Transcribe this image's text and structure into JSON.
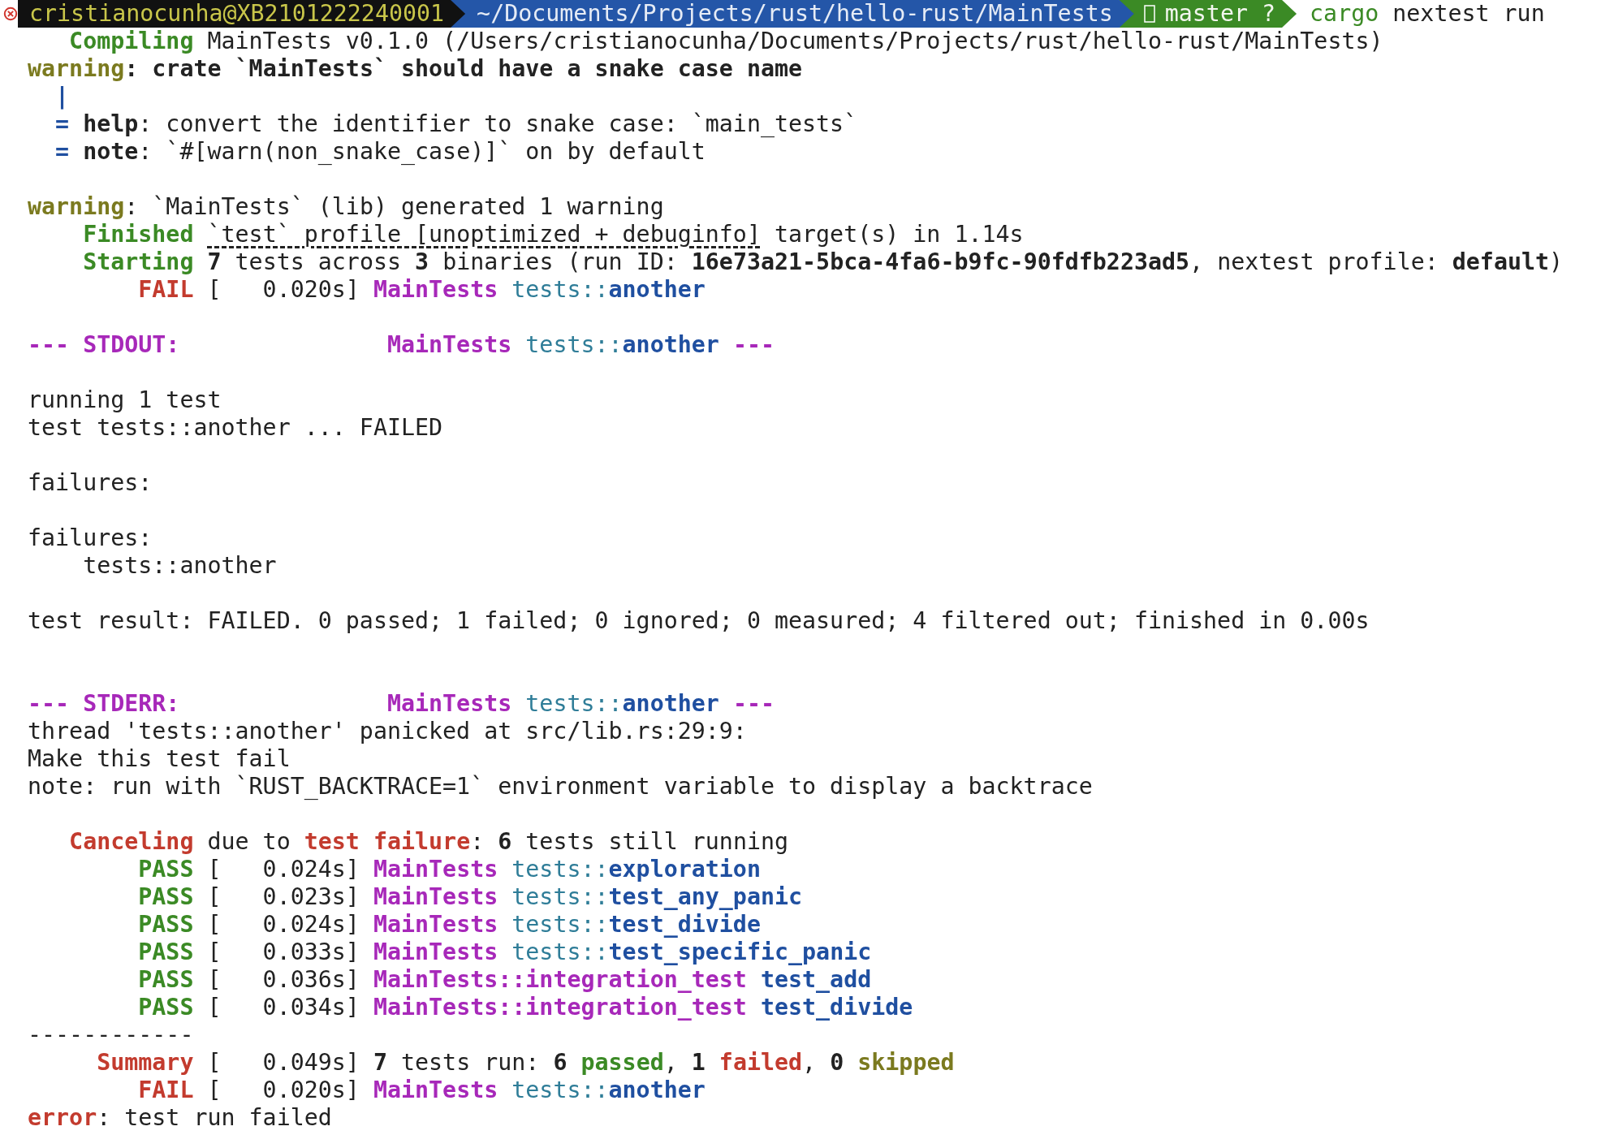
{
  "prompt": {
    "user_host": "cristianocunha@XB2101222240001",
    "path": "~/Documents/Projects/rust/hello-rust/MainTests",
    "branch": "master ?",
    "command": [
      {
        "text": "cargo",
        "kind": "program"
      },
      {
        "text": " nextest run",
        "kind": "text"
      }
    ]
  },
  "lines": [
    {
      "kind": "text",
      "segments": [
        {
          "text": "   Compiling",
          "kind": "status_ok"
        },
        {
          "text": " MainTests v0.1.0 (/Users/cristianocunha/Documents/Projects/rust/hello-rust/MainTests)",
          "kind": "text"
        }
      ]
    },
    {
      "kind": "text",
      "segments": [
        {
          "text": "warning",
          "kind": "warning"
        },
        {
          "text": ": crate `MainTests` should have a snake case name",
          "kind": "emphasis"
        }
      ]
    },
    {
      "kind": "text",
      "segments": [
        {
          "text": "  |",
          "kind": "gutter"
        }
      ]
    },
    {
      "kind": "text",
      "segments": [
        {
          "text": "  =",
          "kind": "gutter"
        },
        {
          "text": " help",
          "kind": "emphasis"
        },
        {
          "text": ": convert the identifier to snake case: `main_tests`",
          "kind": "text"
        }
      ]
    },
    {
      "kind": "text",
      "segments": [
        {
          "text": "  =",
          "kind": "gutter"
        },
        {
          "text": " note",
          "kind": "emphasis"
        },
        {
          "text": ": `#[warn(non_snake_case)]` on by default",
          "kind": "text"
        }
      ]
    },
    {
      "kind": "blank"
    },
    {
      "kind": "text",
      "segments": [
        {
          "text": "warning",
          "kind": "warning"
        },
        {
          "text": ": `MainTests` (lib) generated 1 warning",
          "kind": "text"
        }
      ]
    },
    {
      "kind": "text",
      "segments": [
        {
          "text": "    Finished ",
          "kind": "status_ok"
        },
        {
          "text": "`test` profile [unoptimized + debuginfo]",
          "kind": "underlined"
        },
        {
          "text": " target(s) in 1.14s",
          "kind": "text"
        }
      ]
    },
    {
      "kind": "text",
      "segments": [
        {
          "text": "    Starting ",
          "kind": "status_ok"
        },
        {
          "text": "7",
          "kind": "emphasis"
        },
        {
          "text": " tests across ",
          "kind": "text"
        },
        {
          "text": "3",
          "kind": "emphasis"
        },
        {
          "text": " binaries (run ID: ",
          "kind": "text"
        },
        {
          "text": "16e73a21-5bca-4fa6-b9fc-90fdfb223ad5",
          "kind": "emphasis"
        },
        {
          "text": ", nextest profile: ",
          "kind": "text"
        },
        {
          "text": "default",
          "kind": "emphasis"
        },
        {
          "text": ")",
          "kind": "text"
        }
      ]
    },
    {
      "kind": "text",
      "segments": [
        {
          "text": "        FAIL",
          "kind": "status_fail"
        },
        {
          "text": " [   0.020s] ",
          "kind": "text"
        },
        {
          "text": "MainTests",
          "kind": "crate"
        },
        {
          "text": " tests::",
          "kind": "module"
        },
        {
          "text": "another",
          "kind": "test_name"
        }
      ]
    },
    {
      "kind": "blank"
    },
    {
      "kind": "text",
      "segments": [
        {
          "text": "--- STDOUT:               MainTests",
          "kind": "crate"
        },
        {
          "text": " tests::",
          "kind": "module"
        },
        {
          "text": "another",
          "kind": "test_name"
        },
        {
          "text": " ---",
          "kind": "crate"
        }
      ]
    },
    {
      "kind": "blank"
    },
    {
      "kind": "text",
      "segments": [
        {
          "text": "running 1 test",
          "kind": "text"
        }
      ]
    },
    {
      "kind": "text",
      "segments": [
        {
          "text": "test tests::another ... FAILED",
          "kind": "text"
        }
      ]
    },
    {
      "kind": "blank"
    },
    {
      "kind": "text",
      "segments": [
        {
          "text": "failures:",
          "kind": "text"
        }
      ]
    },
    {
      "kind": "blank"
    },
    {
      "kind": "text",
      "segments": [
        {
          "text": "failures:",
          "kind": "text"
        }
      ]
    },
    {
      "kind": "text",
      "segments": [
        {
          "text": "    tests::another",
          "kind": "text"
        }
      ]
    },
    {
      "kind": "blank"
    },
    {
      "kind": "text",
      "segments": [
        {
          "text": "test result: FAILED. 0 passed; 1 failed; 0 ignored; 0 measured; 4 filtered out; finished in 0.00s",
          "kind": "text"
        }
      ]
    },
    {
      "kind": "blank"
    },
    {
      "kind": "blank"
    },
    {
      "kind": "text",
      "segments": [
        {
          "text": "--- STDERR:               MainTests",
          "kind": "crate"
        },
        {
          "text": " tests::",
          "kind": "module"
        },
        {
          "text": "another",
          "kind": "test_name"
        },
        {
          "text": " ---",
          "kind": "crate"
        }
      ]
    },
    {
      "kind": "text",
      "segments": [
        {
          "text": "thread 'tests::another' panicked at src/lib.rs:29:9:",
          "kind": "text"
        }
      ]
    },
    {
      "kind": "text",
      "segments": [
        {
          "text": "Make this test fail",
          "kind": "text"
        }
      ]
    },
    {
      "kind": "text",
      "segments": [
        {
          "text": "note: run with `RUST_BACKTRACE=1` environment variable to display a backtrace",
          "kind": "text"
        }
      ]
    },
    {
      "kind": "blank"
    },
    {
      "kind": "text",
      "segments": [
        {
          "text": "   Canceling",
          "kind": "status_fail"
        },
        {
          "text": " due to ",
          "kind": "text"
        },
        {
          "text": "test failure",
          "kind": "status_fail"
        },
        {
          "text": ": ",
          "kind": "text"
        },
        {
          "text": "6",
          "kind": "emphasis"
        },
        {
          "text": " tests still running",
          "kind": "text"
        }
      ]
    },
    {
      "kind": "text",
      "segments": [
        {
          "text": "        PASS",
          "kind": "status_ok"
        },
        {
          "text": " [   0.024s] ",
          "kind": "text"
        },
        {
          "text": "MainTests",
          "kind": "crate"
        },
        {
          "text": " tests::",
          "kind": "module"
        },
        {
          "text": "exploration",
          "kind": "test_name"
        }
      ]
    },
    {
      "kind": "text",
      "segments": [
        {
          "text": "        PASS",
          "kind": "status_ok"
        },
        {
          "text": " [   0.023s] ",
          "kind": "text"
        },
        {
          "text": "MainTests",
          "kind": "crate"
        },
        {
          "text": " tests::",
          "kind": "module"
        },
        {
          "text": "test_any_panic",
          "kind": "test_name"
        }
      ]
    },
    {
      "kind": "text",
      "segments": [
        {
          "text": "        PASS",
          "kind": "status_ok"
        },
        {
          "text": " [   0.024s] ",
          "kind": "text"
        },
        {
          "text": "MainTests",
          "kind": "crate"
        },
        {
          "text": " tests::",
          "kind": "module"
        },
        {
          "text": "test_divide",
          "kind": "test_name"
        }
      ]
    },
    {
      "kind": "text",
      "segments": [
        {
          "text": "        PASS",
          "kind": "status_ok"
        },
        {
          "text": " [   0.033s] ",
          "kind": "text"
        },
        {
          "text": "MainTests",
          "kind": "crate"
        },
        {
          "text": " tests::",
          "kind": "module"
        },
        {
          "text": "test_specific_panic",
          "kind": "test_name"
        }
      ]
    },
    {
      "kind": "text",
      "segments": [
        {
          "text": "        PASS",
          "kind": "status_ok"
        },
        {
          "text": " [   0.036s] ",
          "kind": "text"
        },
        {
          "text": "MainTests::integration_test ",
          "kind": "crate"
        },
        {
          "text": "test_add",
          "kind": "test_name"
        }
      ]
    },
    {
      "kind": "text",
      "segments": [
        {
          "text": "        PASS",
          "kind": "status_ok"
        },
        {
          "text": " [   0.034s] ",
          "kind": "text"
        },
        {
          "text": "MainTests::integration_test ",
          "kind": "crate"
        },
        {
          "text": "test_divide",
          "kind": "test_name"
        }
      ]
    },
    {
      "kind": "text",
      "segments": [
        {
          "text": "------------",
          "kind": "text"
        }
      ]
    },
    {
      "kind": "text",
      "segments": [
        {
          "text": "     Summary",
          "kind": "status_fail"
        },
        {
          "text": " [   0.049s] ",
          "kind": "text"
        },
        {
          "text": "7",
          "kind": "emphasis"
        },
        {
          "text": " tests run: ",
          "kind": "text"
        },
        {
          "text": "6 ",
          "kind": "emphasis"
        },
        {
          "text": "passed",
          "kind": "status_ok"
        },
        {
          "text": ", ",
          "kind": "text"
        },
        {
          "text": "1 ",
          "kind": "emphasis"
        },
        {
          "text": "failed",
          "kind": "status_fail"
        },
        {
          "text": ", ",
          "kind": "text"
        },
        {
          "text": "0 ",
          "kind": "emphasis"
        },
        {
          "text": "skipped",
          "kind": "warning"
        }
      ]
    },
    {
      "kind": "text",
      "segments": [
        {
          "text": "        FAIL",
          "kind": "status_fail"
        },
        {
          "text": " [   0.020s] ",
          "kind": "text"
        },
        {
          "text": "MainTests",
          "kind": "crate"
        },
        {
          "text": " tests::",
          "kind": "module"
        },
        {
          "text": "another",
          "kind": "test_name"
        }
      ]
    },
    {
      "kind": "text",
      "segments": [
        {
          "text": "error",
          "kind": "status_fail"
        },
        {
          "text": ": test run failed",
          "kind": "text"
        }
      ]
    }
  ]
}
